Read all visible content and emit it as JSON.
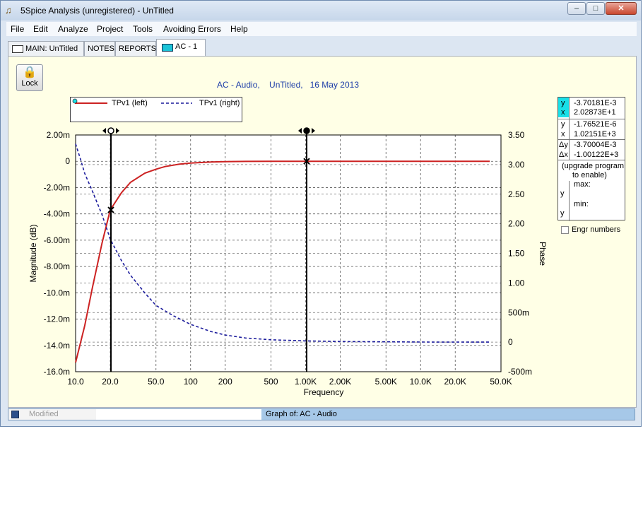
{
  "window": {
    "title": "5Spice Analysis (unregistered) - UnTitled",
    "minimize_glyph": "‒",
    "maximize_glyph": "□",
    "close_glyph": "✕"
  },
  "menu": [
    "File",
    "Edit",
    "Analyze",
    "Project",
    "Tools",
    "Avoiding Errors",
    "Help"
  ],
  "tabs": [
    {
      "label": "MAIN:  UnTitled",
      "active": false
    },
    {
      "label": "NOTES",
      "active": false
    },
    {
      "label": "REPORTS",
      "active": false
    },
    {
      "label": "AC - 1",
      "active": true
    }
  ],
  "toolbar": {
    "lock_label": "Lock"
  },
  "graph": {
    "title": "AC - Audio,    UnTitled,   16 May 2013",
    "legend": [
      {
        "name": "TPv1 (left)",
        "color": "#cc2222",
        "style": "solid"
      },
      {
        "name": "TPv1 (right)",
        "color": "#1c1c9c",
        "style": "dashed"
      }
    ]
  },
  "readout": {
    "rows": [
      {
        "key": "y",
        "value": "-3.70181E-3"
      },
      {
        "key": "x",
        "value": "2.02873E+1"
      },
      {
        "key": "y",
        "value": "-1.76521E-6"
      },
      {
        "key": "x",
        "value": "1.02151E+3"
      },
      {
        "key": "Δy",
        "value": "-3.70004E-3"
      },
      {
        "key": "Δx",
        "value": "-1.00122E+3"
      }
    ],
    "upgrade_line1": "(upgrade program",
    "upgrade_line2": "to enable)",
    "max_label": "max:",
    "min_label": "min:",
    "y_label": "y",
    "engr_label": "Engr numbers"
  },
  "status": {
    "left": "Modified",
    "graph_of": "Graph of:  AC - Audio"
  },
  "chart_data": {
    "type": "line",
    "xlabel": "Frequency",
    "ylabel": "Magnitude  (dB)",
    "y2label": "Phase",
    "xscale": "log",
    "xlim": [
      10,
      50000
    ],
    "ylim": [
      -0.016,
      0.002
    ],
    "y2lim": [
      -0.5,
      3.5
    ],
    "grid": true,
    "legend_position": "top-left",
    "x_ticks": [
      {
        "v": 10,
        "label": "10.0"
      },
      {
        "v": 20,
        "label": "20.0"
      },
      {
        "v": 50,
        "label": "50.0"
      },
      {
        "v": 100,
        "label": "100"
      },
      {
        "v": 200,
        "label": "200"
      },
      {
        "v": 500,
        "label": "500"
      },
      {
        "v": 1000,
        "label": "1.00K"
      },
      {
        "v": 2000,
        "label": "2.00K"
      },
      {
        "v": 5000,
        "label": "5.00K"
      },
      {
        "v": 10000,
        "label": "10.0K"
      },
      {
        "v": 20000,
        "label": "20.0K"
      },
      {
        "v": 50000,
        "label": "50.0K"
      }
    ],
    "y_ticks": [
      {
        "v": 0.002,
        "label": "2.00m"
      },
      {
        "v": 0,
        "label": "0"
      },
      {
        "v": -0.002,
        "label": "-2.00m"
      },
      {
        "v": -0.004,
        "label": "-4.00m"
      },
      {
        "v": -0.006,
        "label": "-6.00m"
      },
      {
        "v": -0.008,
        "label": "-8.00m"
      },
      {
        "v": -0.01,
        "label": "-10.0m"
      },
      {
        "v": -0.012,
        "label": "-12.0m"
      },
      {
        "v": -0.014,
        "label": "-14.0m"
      },
      {
        "v": -0.016,
        "label": "-16.0m"
      }
    ],
    "y2_ticks": [
      {
        "v": 3.5,
        "label": "3.50"
      },
      {
        "v": 3.0,
        "label": "3.00"
      },
      {
        "v": 2.5,
        "label": "2.50"
      },
      {
        "v": 2.0,
        "label": "2.00"
      },
      {
        "v": 1.5,
        "label": "1.50"
      },
      {
        "v": 1.0,
        "label": "1.00"
      },
      {
        "v": 0.5,
        "label": "500m"
      },
      {
        "v": 0,
        "label": "0"
      },
      {
        "v": -0.5,
        "label": "-500m"
      }
    ],
    "series": [
      {
        "name": "TPv1 (left)",
        "axis": "left",
        "color": "#cc2222",
        "dash": false,
        "x": [
          10,
          12,
          14,
          17,
          20,
          25,
          30,
          40,
          50,
          60,
          80,
          100,
          150,
          200,
          300,
          500,
          1000,
          2000,
          5000,
          10000,
          20000,
          40000
        ],
        "y": [
          -0.0153,
          -0.0125,
          -0.0096,
          -0.0062,
          -0.0037,
          -0.0024,
          -0.0016,
          -0.0009,
          -0.0006,
          -0.0004,
          -0.00022,
          -0.00014,
          -6e-05,
          -3e-05,
          -1e-05,
          0,
          0,
          0,
          0,
          0,
          0,
          0
        ]
      },
      {
        "name": "TPv1 (right)",
        "axis": "right",
        "color": "#1c1c9c",
        "dash": true,
        "x": [
          10,
          11,
          12,
          14,
          17,
          20,
          25,
          30,
          40,
          50,
          70,
          100,
          150,
          200,
          300,
          500,
          1000,
          2000,
          5000,
          10000,
          40000
        ],
        "y": [
          3.35,
          3.1,
          2.85,
          2.55,
          2.15,
          1.74,
          1.38,
          1.13,
          0.83,
          0.62,
          0.45,
          0.3,
          0.18,
          0.12,
          0.07,
          0.04,
          0.02,
          0.01,
          0.005,
          0.002,
          0.0
        ]
      }
    ],
    "cursors": [
      {
        "x": 20.2873,
        "y": -0.0037
      },
      {
        "x": 1021.51,
        "y": 0
      }
    ]
  }
}
